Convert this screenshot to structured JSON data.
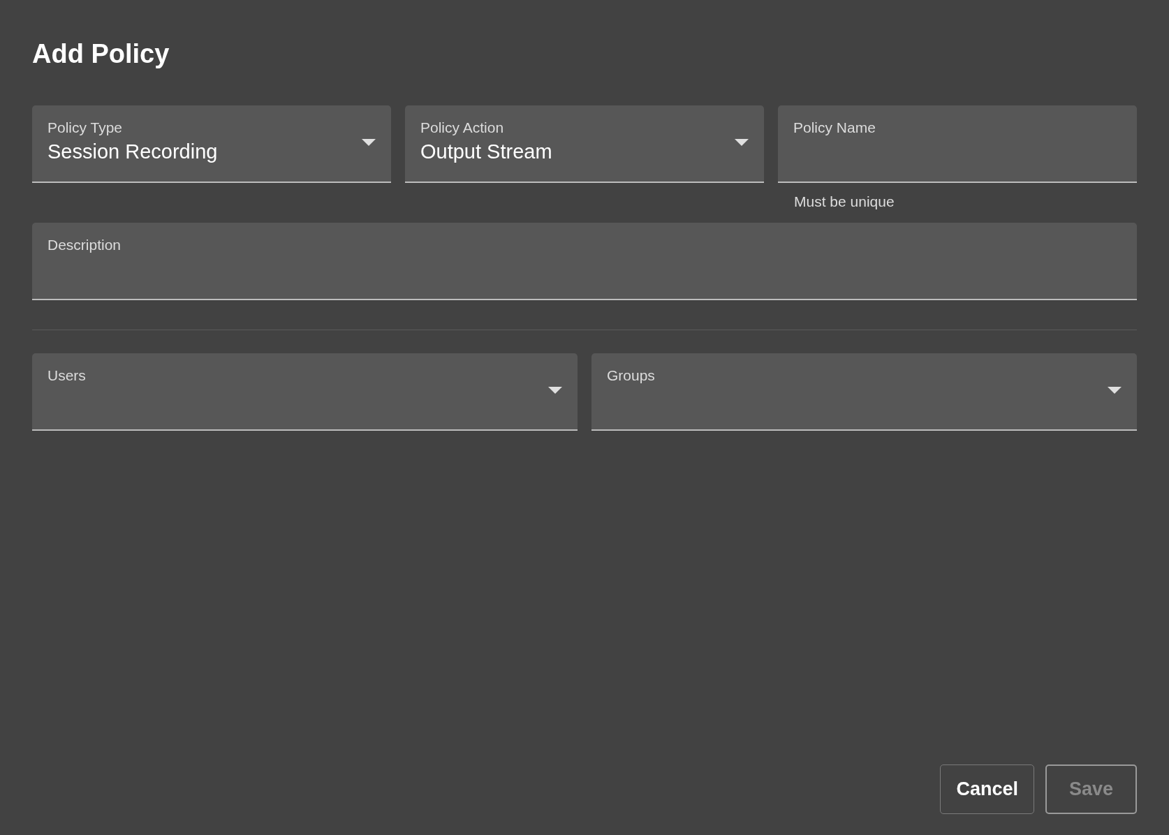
{
  "title": "Add Policy",
  "sections": [
    {
      "rows": [
        [
          {
            "kind": "select",
            "label": "Policy Type",
            "value": "Session Recording"
          },
          {
            "kind": "select",
            "label": "Policy Action",
            "value": "Output Stream"
          },
          {
            "kind": "text",
            "label": "Policy Name",
            "helper": "Must be unique"
          }
        ],
        [
          {
            "kind": "text",
            "label": "Description"
          }
        ]
      ]
    },
    {
      "rows": [
        [
          {
            "kind": "select",
            "label": "Users"
          },
          {
            "kind": "select",
            "label": "Groups"
          }
        ]
      ]
    }
  ],
  "buttons": [
    {
      "label": "Cancel",
      "disabled": false
    },
    {
      "label": "Save",
      "disabled": true
    }
  ]
}
